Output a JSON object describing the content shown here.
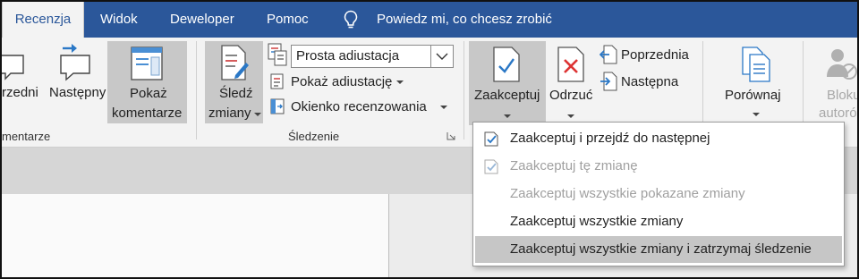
{
  "tabs": [
    "Recenzja",
    "Widok",
    "Deweloper",
    "Pomoc"
  ],
  "tell_me": "Powiedz mi, co chcesz zrobić",
  "comments_group": {
    "previous_label": "rzedni",
    "next_label": "Następny",
    "show_line1": "Pokaż",
    "show_line2": "komentarze",
    "group_label": "mentarze"
  },
  "tracking_group": {
    "track_line1": "Śledź",
    "track_line2": "zmiany",
    "markup_select": "Prosta adiustacja",
    "show_markup": "Pokaż adiustację",
    "reviewing_pane": "Okienko recenzowania",
    "group_label": "Śledzenie"
  },
  "changes_group": {
    "accept": "Zaakceptuj",
    "reject": "Odrzuć",
    "previous": "Poprzednia",
    "next": "Następna"
  },
  "compare": "Porównaj",
  "block_line1": "Bloku",
  "block_line2": "autoró",
  "accept_menu": [
    {
      "label": "Zaakceptuj i przejdź do następnej",
      "icon": "accept-move-icon",
      "enabled": true
    },
    {
      "label": "Zaakceptuj tę zmianę",
      "icon": "accept-change-icon",
      "enabled": false
    },
    {
      "label": "Zaakceptuj wszystkie pokazane zmiany",
      "icon": "",
      "enabled": false
    },
    {
      "label": "Zaakceptuj wszystkie zmiany",
      "icon": "",
      "enabled": true
    },
    {
      "label": "Zaakceptuj wszystkie zmiany i zatrzymaj śledzenie",
      "icon": "",
      "enabled": true,
      "highlighted": true
    }
  ]
}
